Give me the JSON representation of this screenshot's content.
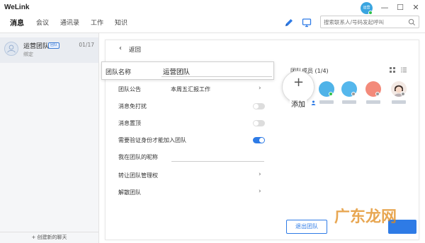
{
  "app": {
    "title": "WeLink",
    "user_initials": "运营"
  },
  "window_controls": {
    "minimize": "—",
    "maximize": "☐",
    "close": "✕"
  },
  "nav": {
    "items": [
      {
        "label": "消息",
        "active": true
      },
      {
        "label": "会议"
      },
      {
        "label": "通讯录"
      },
      {
        "label": "工作"
      },
      {
        "label": "知识"
      }
    ]
  },
  "search": {
    "placeholder": "搜索联系人/号码发起呼叫"
  },
  "sidebar": {
    "conversation": {
      "name": "运营团队",
      "badge": "团队",
      "date": "01/17",
      "subtitle": "绑定"
    },
    "create_label": "+ 创建新的聊天"
  },
  "detail": {
    "back_label": "返回",
    "team_name_label": "团队名称",
    "team_name_value": "运营团队",
    "rows": [
      {
        "label": "团队公告",
        "value": "本周五汇报工作"
      },
      {
        "label": "消息免打扰",
        "toggle": false
      },
      {
        "label": "消息置顶",
        "toggle": false
      },
      {
        "label": "需要验证身份才能加入团队",
        "toggle": true
      },
      {
        "label": "我在团队的昵称"
      },
      {
        "label": "转让团队管理权"
      },
      {
        "label": "解散团队"
      }
    ],
    "members_title": "团队成员 (1/4)",
    "add_label": "添加",
    "exit_label": "退出团队"
  },
  "watermark": {
    "text": "广东龙网"
  },
  "colors": {
    "accent": "#2e7be6",
    "online": "#2ec04a"
  }
}
